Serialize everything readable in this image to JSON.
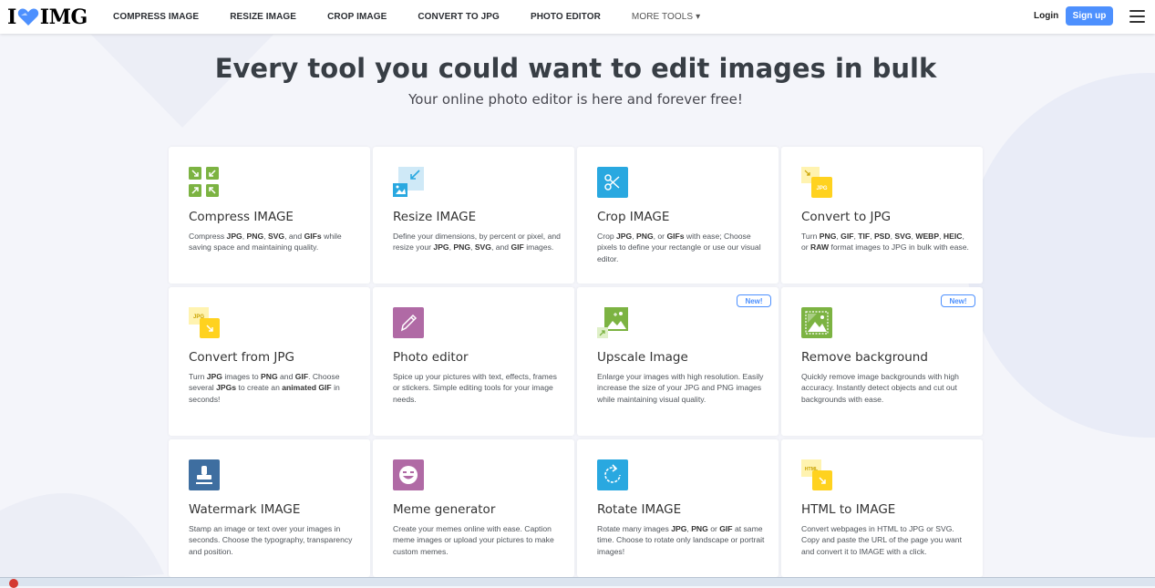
{
  "brand": {
    "prefix": "I",
    "suffix": "IMG"
  },
  "nav": {
    "items": [
      "COMPRESS IMAGE",
      "RESIZE IMAGE",
      "CROP IMAGE",
      "CONVERT TO JPG",
      "PHOTO EDITOR"
    ],
    "more": "MORE TOOLS ▾",
    "login": "Login",
    "signup": "Sign up"
  },
  "hero": {
    "title": "Every tool you could want to edit images in bulk",
    "subtitle": "Your online photo editor is here and forever free!"
  },
  "tools": [
    {
      "title": "Compress IMAGE",
      "desc": "Compress JPG, PNG, SVG, and GIFs while saving space and maintaining quality.",
      "icon": "compress-icon"
    },
    {
      "title": "Resize IMAGE",
      "desc": "Define your dimensions, by percent or pixel, and resize your JPG, PNG, SVG, and GIF images.",
      "icon": "resize-icon"
    },
    {
      "title": "Crop IMAGE",
      "desc": "Crop JPG, PNG, or GIFs with ease; Choose pixels to define your rectangle or use our visual editor.",
      "icon": "crop-icon"
    },
    {
      "title": "Convert to JPG",
      "desc": "Turn PNG, GIF, TIF, PSD, SVG, WEBP, HEIC, or RAW format images to JPG in bulk with ease.",
      "icon": "convert-to-jpg-icon"
    },
    {
      "title": "Convert from JPG",
      "desc": "Turn JPG images to PNG and GIF. Choose several JPGs to create an animated GIF in seconds!",
      "icon": "convert-from-jpg-icon"
    },
    {
      "title": "Photo editor",
      "desc": "Spice up your pictures with text, effects, frames or stickers. Simple editing tools for your image needs.",
      "icon": "photo-editor-icon"
    },
    {
      "title": "Upscale Image",
      "desc": "Enlarge your images with high resolution. Easily increase the size of your JPG and PNG images while maintaining visual quality.",
      "icon": "upscale-icon",
      "badge": "New!"
    },
    {
      "title": "Remove background",
      "desc": "Quickly remove image backgrounds with high accuracy. Instantly detect objects and cut out backgrounds with ease.",
      "icon": "remove-background-icon",
      "badge": "New!"
    },
    {
      "title": "Watermark IMAGE",
      "desc": "Stamp an image or text over your images in seconds. Choose the typography, transparency and position.",
      "icon": "watermark-icon"
    },
    {
      "title": "Meme generator",
      "desc": "Create your memes online with ease. Caption meme images or upload your pictures to make custom memes.",
      "icon": "meme-icon"
    },
    {
      "title": "Rotate IMAGE",
      "desc": "Rotate many images JPG, PNG or GIF at same time. Choose to rotate only landscape or portrait images!",
      "icon": "rotate-icon"
    },
    {
      "title": "HTML to IMAGE",
      "desc": "Convert webpages in HTML to JPG or SVG. Copy and paste the URL of the page you want and convert it to IMAGE with a click.",
      "icon": "html-to-image-icon"
    }
  ],
  "colors": {
    "accent": "#4d90fe",
    "green": "#7cb342",
    "teal": "#29a8e0",
    "yellow": "#ffd21f",
    "purple": "#b06aa5",
    "navy": "#3e6ea0"
  }
}
